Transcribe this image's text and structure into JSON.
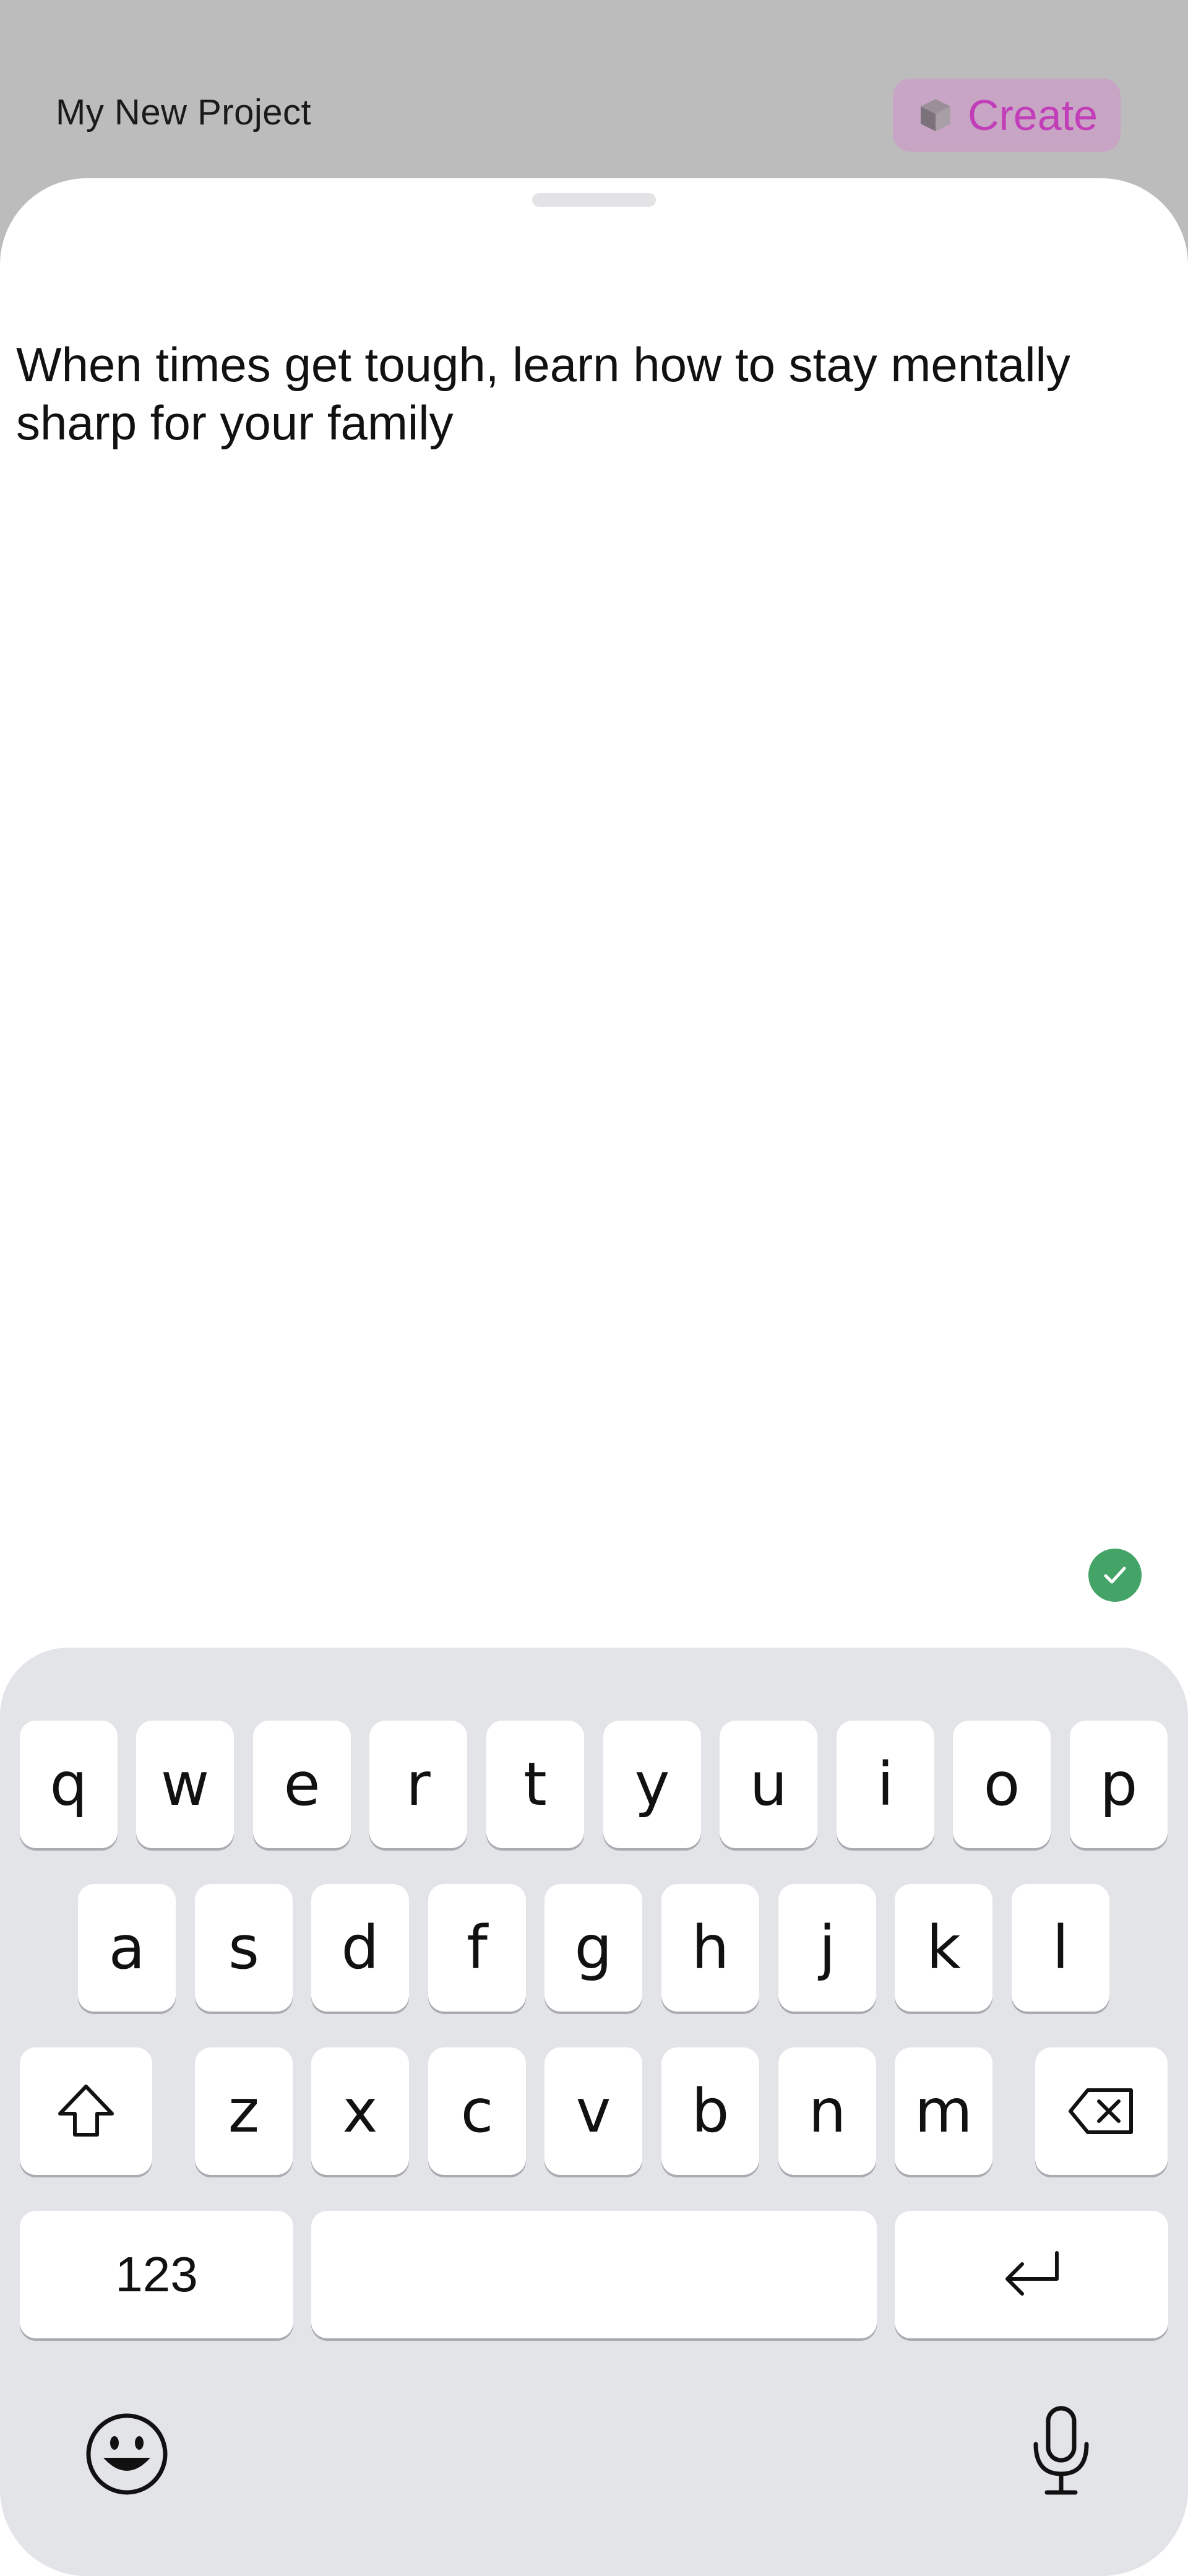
{
  "header": {
    "project_title": "My New Project",
    "create_label": "Create",
    "create_icon": "cube-icon",
    "accent_color": "#c23db8"
  },
  "editor": {
    "text": "When times get tough, learn how to stay mentally\nsharp for your family",
    "status_icon": "checkmark-circle-icon",
    "status_color": "#44a467"
  },
  "keyboard": {
    "row1": [
      "q",
      "w",
      "e",
      "r",
      "t",
      "y",
      "u",
      "i",
      "o",
      "p"
    ],
    "row2": [
      "a",
      "s",
      "d",
      "f",
      "g",
      "h",
      "j",
      "k",
      "l"
    ],
    "row3": [
      "z",
      "x",
      "c",
      "v",
      "b",
      "n",
      "m"
    ],
    "numbers_label": "123",
    "icons": {
      "shift": "shift-icon",
      "backspace": "backspace-icon",
      "return": "return-icon",
      "emoji": "emoji-icon",
      "microphone": "microphone-icon"
    }
  }
}
